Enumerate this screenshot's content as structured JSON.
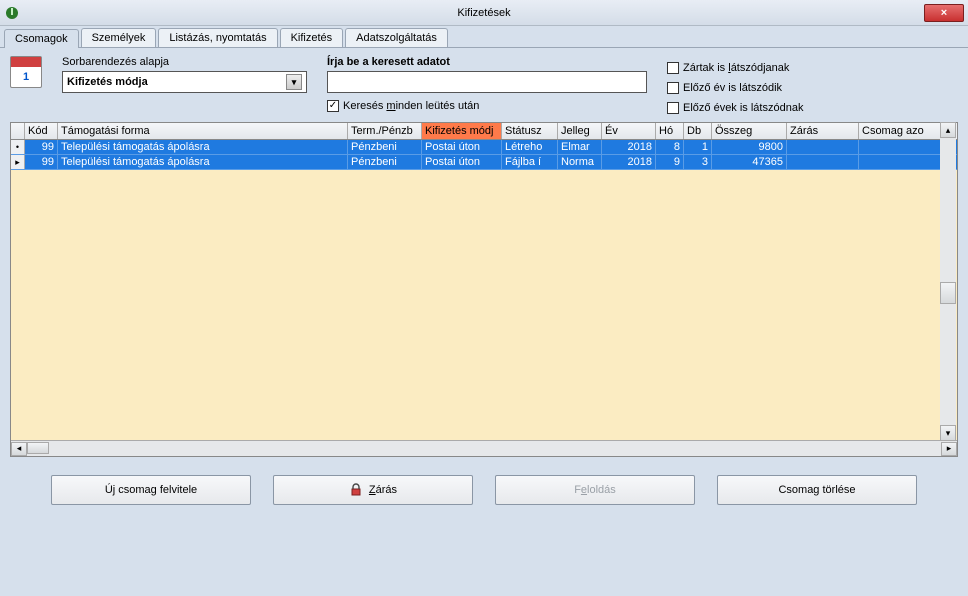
{
  "window": {
    "title": "Kifizetések",
    "close_icon": "×"
  },
  "tabs": [
    "Csomagok",
    "Személyek",
    "Listázás, nyomtatás",
    "Kifizetés",
    "Adatszolgáltatás"
  ],
  "sort": {
    "label": "Sorbarendezés alapja",
    "value": "Kifizetés módja"
  },
  "search": {
    "label": "Írja be a keresett adatot",
    "value": "",
    "after_key_label": "Keresés minden leütés után",
    "after_key_checked": true
  },
  "right_checks": [
    {
      "label": "Zártak is látszódjanak",
      "checked": false,
      "accel": "l"
    },
    {
      "label": "Előző év is látszódik",
      "checked": false,
      "accel": null
    },
    {
      "label": "Előző évek is látszódnak",
      "checked": false,
      "accel": null
    }
  ],
  "grid": {
    "columns": [
      "Kód",
      "Támogatási forma",
      "Term./Pénzb",
      "Kifizetés módj",
      "Státusz",
      "Jelleg",
      "Év",
      "Hó",
      "Db",
      "Összeg",
      "Zárás",
      "Csomag azo"
    ],
    "sorted_column_index": 3,
    "rows": [
      {
        "marker": "•",
        "kod": "99",
        "forma": "Települési támogatás ápolásra",
        "term": "Pénzbeni",
        "mod": "Postai úton",
        "statusz": "Létreho",
        "jelleg": "Elmar",
        "ev": "2018",
        "ho": "8",
        "db": "1",
        "osszeg": "9800",
        "zaras": "",
        "csaz": ""
      },
      {
        "marker": "▸",
        "kod": "99",
        "forma": "Települési támogatás ápolásra",
        "term": "Pénzbeni",
        "mod": "Postai úton",
        "statusz": "Fájlba í",
        "jelleg": "Norma",
        "ev": "2018",
        "ho": "9",
        "db": "3",
        "osszeg": "47365",
        "zaras": "",
        "csaz": ""
      }
    ]
  },
  "buttons": {
    "new": "Új csomag felvitele",
    "lock": "Zárás",
    "unlock": "Feloldás",
    "delete": "Csomag törlése"
  },
  "cal_icon_day": "1"
}
